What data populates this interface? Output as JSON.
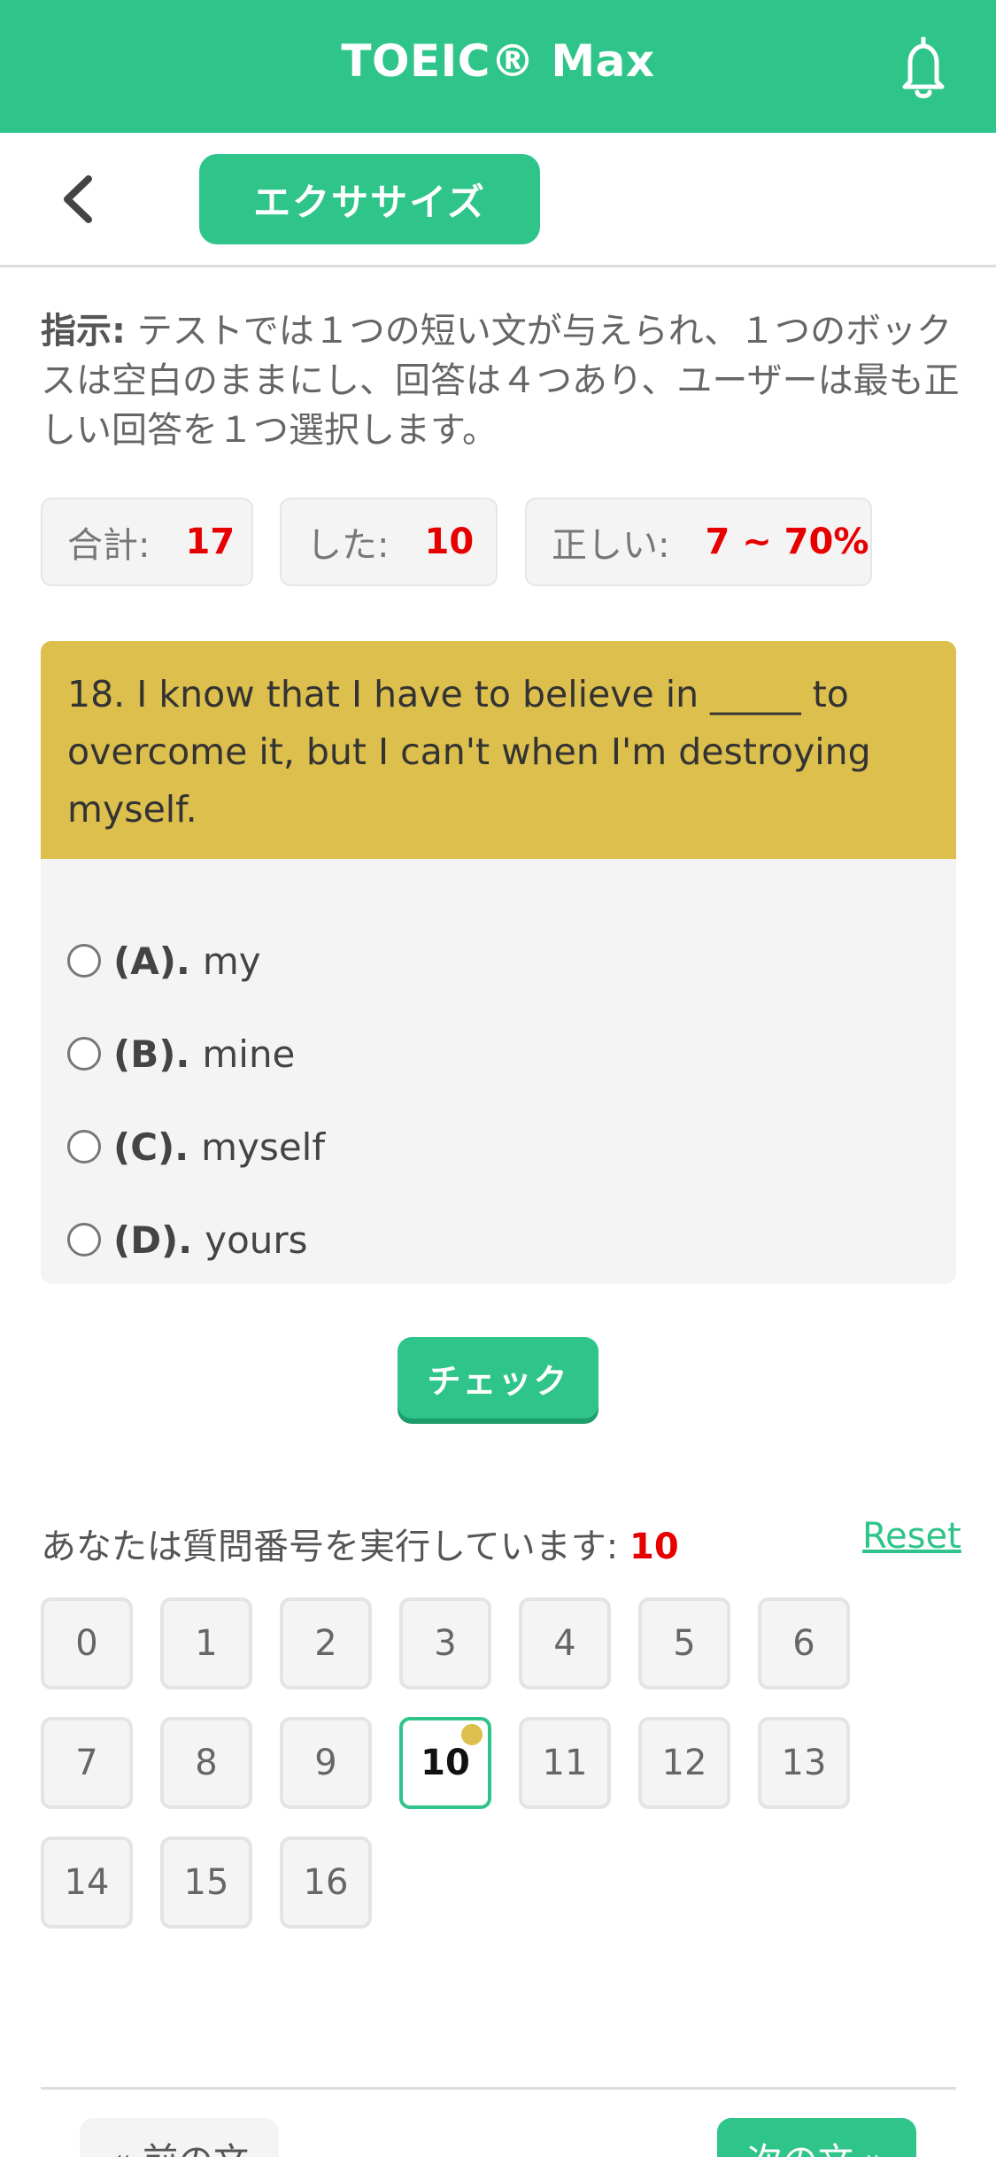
{
  "header": {
    "title": "TOEIC® Max",
    "bell_icon": "bell-icon",
    "color": "#2ec48a"
  },
  "subbar": {
    "back_icon": "chevron-left-icon",
    "tab_label": "エクササイズ"
  },
  "instructions": {
    "label": "指示:",
    "text": " テストでは１つの短い文が与えられ、１つのボックスは空白のままにし、回答は４つあり、ユーザーは最も正しい回答を１つ選択します。"
  },
  "stats": {
    "total_label": "合計:",
    "total_value": "17",
    "done_label": "した:",
    "done_value": "10",
    "correct_label": "正しい:",
    "correct_value": "7 ~ 70%"
  },
  "question": {
    "text": "18. I know that I have to believe in _____ to overcome it, but I can't when I'm destroying myself.",
    "header_color": "#dcbf4c",
    "options": [
      {
        "label": "(A).",
        "text": "my"
      },
      {
        "label": "(B).",
        "text": "mine"
      },
      {
        "label": "(C).",
        "text": "myself"
      },
      {
        "label": "(D).",
        "text": "yours"
      }
    ]
  },
  "check_label": "チェック",
  "progress": {
    "running_label": "あなたは質問番号を実行しています:",
    "current": "10",
    "reset_label": "Reset",
    "numbers": [
      "0",
      "1",
      "2",
      "3",
      "4",
      "5",
      "6",
      "7",
      "8",
      "9",
      "10",
      "11",
      "12",
      "13",
      "14",
      "15",
      "16"
    ]
  },
  "footer": {
    "prev_label": "« 前の文",
    "next_label": "次の文 »"
  }
}
